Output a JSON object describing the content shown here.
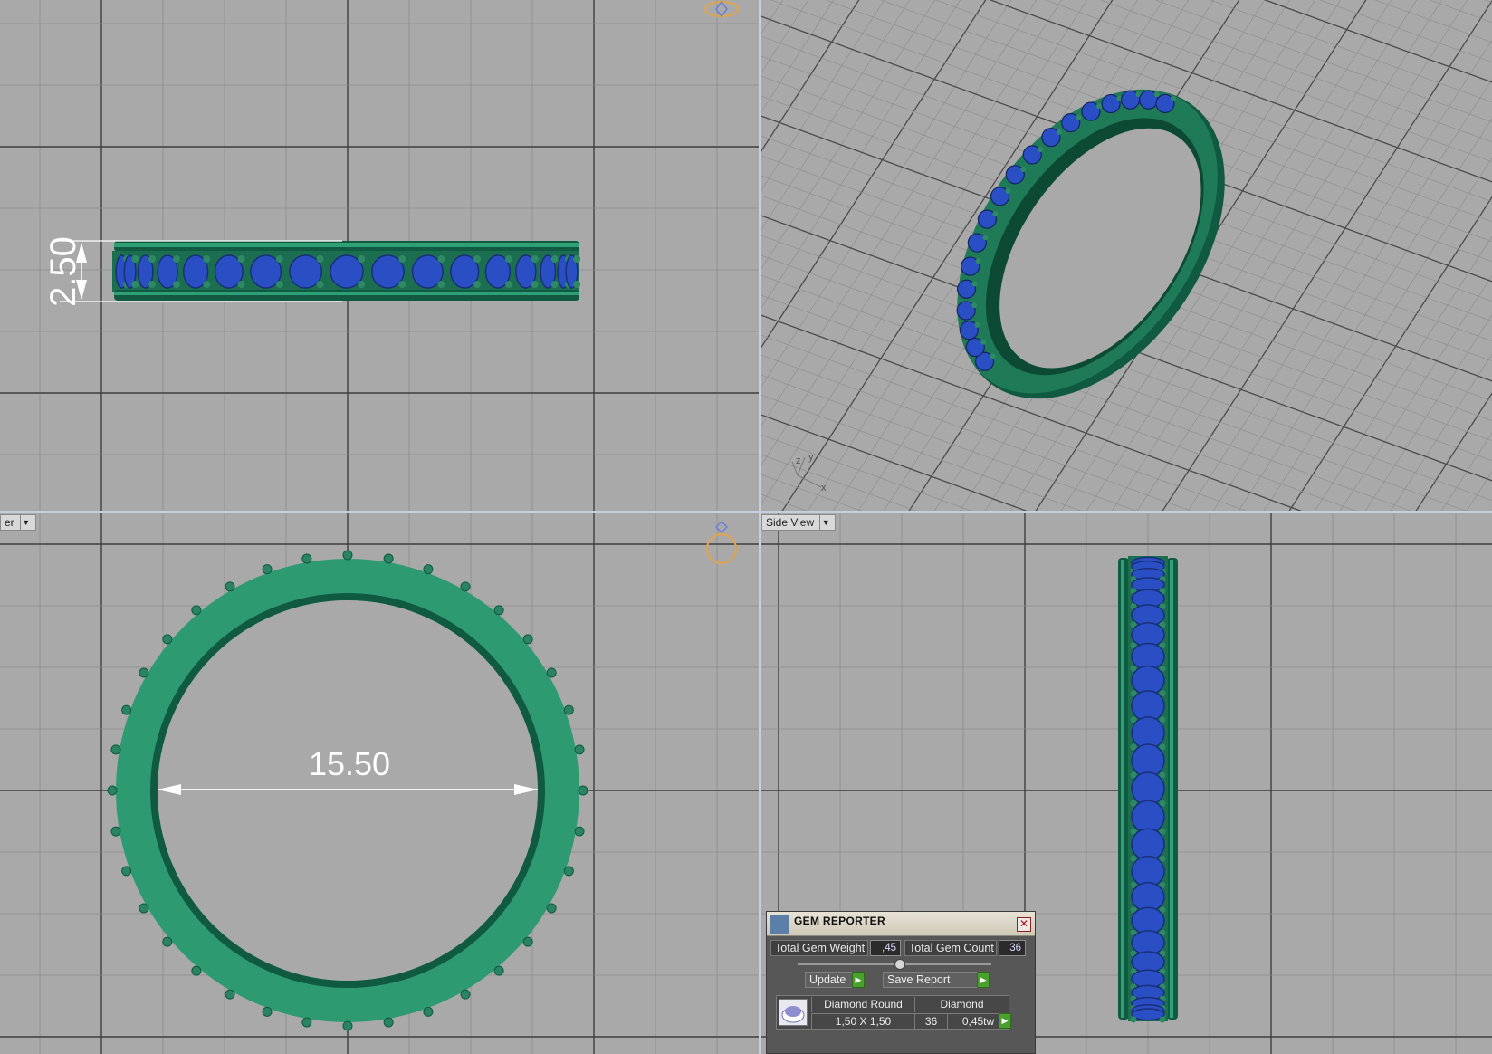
{
  "viewports": {
    "front": {
      "dimension_label": "2.50"
    },
    "top": {
      "label_partial": "er",
      "dimension_label": "15.50"
    },
    "side": {
      "label": "Side View"
    },
    "perspective": {
      "axis_labels": {
        "x": "x",
        "y": "y",
        "z": "z"
      }
    }
  },
  "gem_reporter": {
    "title": "GEM REPORTER",
    "total_gem_weight_label": "Total Gem Weight",
    "total_gem_weight_value": ",45",
    "total_gem_count_label": "Total Gem Count",
    "total_gem_count_value": "36",
    "update_label": "Update",
    "save_report_label": "Save Report",
    "gem": {
      "name": "Diamond Round",
      "material": "Diamond",
      "size": "1,50 X 1,50",
      "count": "36",
      "weight": "0,45tw"
    }
  },
  "colors": {
    "viewport_bg": "#a9a9a9",
    "grid_minor": "#8c8c8c",
    "grid_major": "#3e3e3e",
    "ring_green": "#2e9a72",
    "ring_dark": "#0f5a40",
    "gem_blue": "#2a4fc4",
    "dimension": "#ffffff",
    "accent_go": "#48a12a"
  }
}
